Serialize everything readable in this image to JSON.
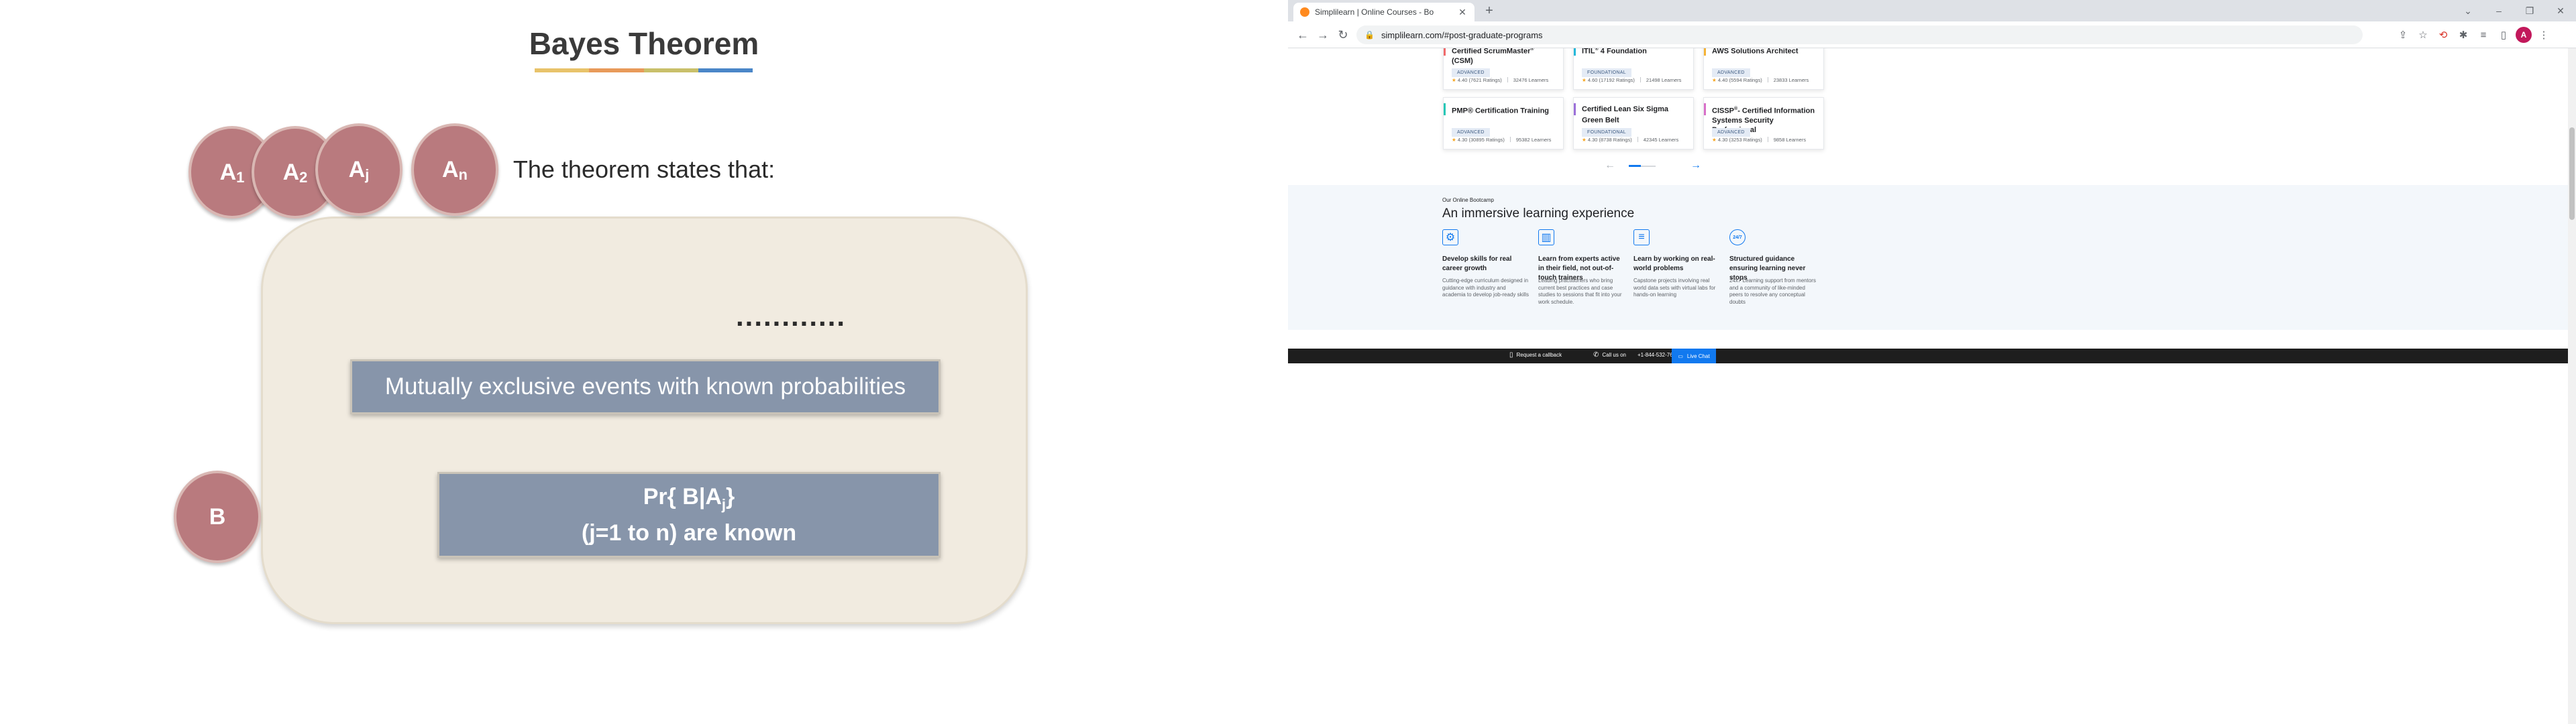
{
  "slide": {
    "title": "Bayes Theorem",
    "underline_colors": [
      "#e8c36a",
      "#e89a5a",
      "#c9c06a",
      "#4a86c8"
    ],
    "subtitle": "The theorem states that:",
    "circles": [
      {
        "base": "A",
        "sub": "1"
      },
      {
        "base": "A",
        "sub": "2"
      },
      {
        "base": "A",
        "sub": "j"
      },
      {
        "base": "A",
        "sub": "n"
      }
    ],
    "dots": "............",
    "events_box": "Mutually exclusive events with known probabilities",
    "b_label": "B",
    "pr_line1_prefix": "Pr{ B|A",
    "pr_line1_sub": "j",
    "pr_line1_suffix": "}",
    "pr_line2": "(j=1 to n) are known"
  },
  "browser": {
    "tab_title": "Simplilearn | Online Courses - Bo",
    "url": "simplilearn.com/#post-graduate-programs",
    "avatar_letter": "A",
    "cards": [
      {
        "title_pre": "Certified ScrumMaster",
        "title_sup": "®",
        "title_post": " (CSM)",
        "badge": "ADVANCED",
        "rating": "4.40 (7621 Ratings)",
        "learners": "32476 Learners",
        "accent": "#f06a6a"
      },
      {
        "title_pre": "ITIL",
        "title_sup": "®",
        "title_post": " 4 Foundation",
        "badge": "FOUNDATIONAL",
        "rating": "4.60 (17192 Ratings)",
        "learners": "21498 Learners",
        "accent": "#23b8d9"
      },
      {
        "title_pre": "AWS Solutions Architect",
        "title_sup": "",
        "title_post": "",
        "badge": "ADVANCED",
        "rating": "4.40 (5594 Ratings)",
        "learners": "23833 Learners",
        "accent": "#f5b335"
      },
      {
        "title_pre": "PMP® Certification Training",
        "title_sup": "",
        "title_post": "",
        "badge": "ADVANCED",
        "rating": "4.30 (30895 Ratings)",
        "learners": "95382 Learners",
        "accent": "#27c7b6"
      },
      {
        "title_pre": "Certified Lean Six Sigma Green Belt",
        "title_sup": "",
        "title_post": "",
        "badge": "FOUNDATIONAL",
        "rating": "4.30 (8738 Ratings)",
        "learners": "42345 Learners",
        "accent": "#9b6fd8"
      },
      {
        "title_pre": "CISSP",
        "title_sup": "®",
        "title_post": "- Certified Information Systems Security Professional",
        "badge": "ADVANCED",
        "rating": "4.30 (3253 Ratings)",
        "learners": "9858 Learners",
        "accent": "#d86fc8"
      }
    ],
    "pager_prev": "←",
    "pager_next": "→",
    "bootcamp_kicker": "Our Online Bootcamp",
    "bootcamp_heading": "An immersive learning experience",
    "features": [
      {
        "icon": "briefcase-icon",
        "glyph": "⚙",
        "title": "Develop skills for real career growth",
        "desc": "Cutting-edge curriculum designed in guidance with industry and academia to develop job-ready skills"
      },
      {
        "icon": "chart-presenter-icon",
        "glyph": "▥",
        "title": "Learn from experts active in their field, not out-of-touch trainers",
        "desc": "Leading practitioners who bring current best practices and case studies to sessions that fit into your work schedule."
      },
      {
        "icon": "document-icon",
        "glyph": "≡",
        "title": "Learn by working on real-world problems",
        "desc": "Capstone projects involving real world data sets with virtual labs for hands-on learning"
      },
      {
        "icon": "support-24x7-icon",
        "glyph": "24/7",
        "title": "Structured guidance ensuring learning never stops",
        "desc": "24x7 Learning support from mentors and a community of like-minded peers to resolve any conceptual doubts"
      }
    ],
    "callback_label": "Request a callback",
    "call_label": "Call us on",
    "phone": "+1-844-532-7688",
    "livechat_label": "Live Chat"
  }
}
